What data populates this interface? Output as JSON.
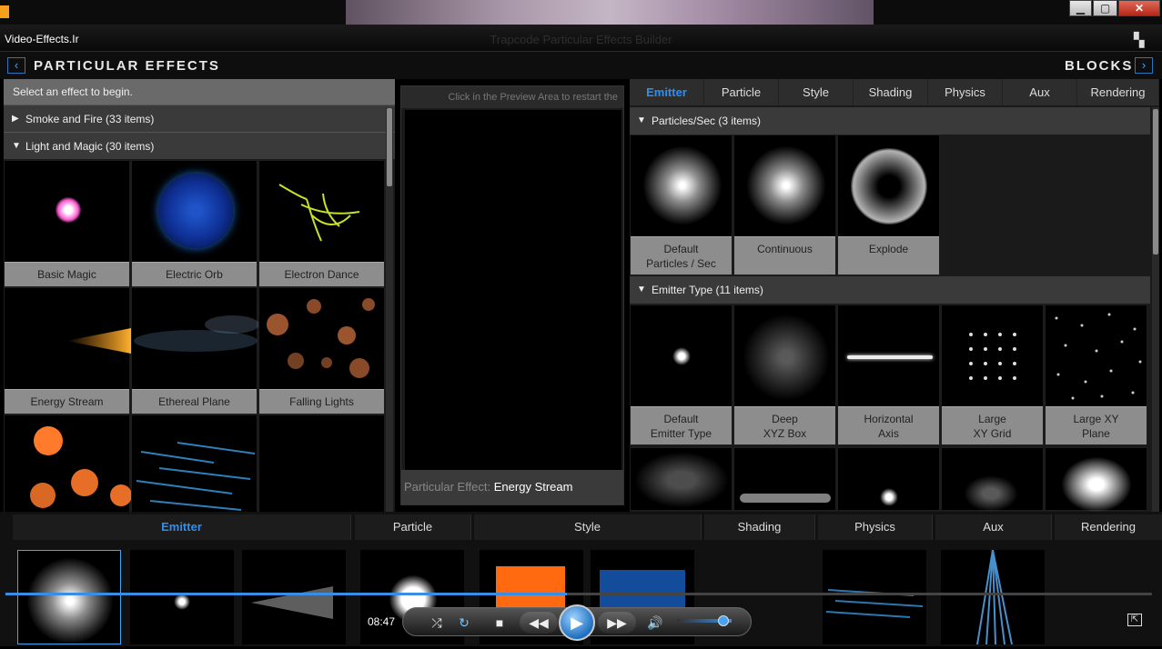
{
  "window": {
    "site": "Video-Effects.Ir",
    "title": "Trapcode Particular Effects Builder",
    "minimize": "▁",
    "maximize": "▢",
    "close": "✕"
  },
  "nav": {
    "left_title": "PARTICULAR EFFECTS",
    "right_title": "BLOCKS",
    "back_icon": "‹",
    "forward_icon": "›"
  },
  "effects_panel": {
    "hint": "Select an effect to begin.",
    "categories": [
      {
        "label": "Smoke and Fire (33 items)",
        "expanded": false
      },
      {
        "label": "Light and Magic (30 items)",
        "expanded": true
      }
    ],
    "effects": [
      {
        "label": "Basic Magic"
      },
      {
        "label": "Electric Orb"
      },
      {
        "label": "Electron Dance"
      },
      {
        "label": "Energy Stream"
      },
      {
        "label": "Ethereal Plane"
      },
      {
        "label": "Falling Lights"
      }
    ]
  },
  "preview": {
    "message": "Click in the Preview Area to restart the",
    "effect_key": "Particular Effect:",
    "effect_value": "Energy Stream"
  },
  "blocks_panel": {
    "tabs": [
      "Emitter",
      "Particle",
      "Style",
      "Shading",
      "Physics",
      "Aux",
      "Rendering"
    ],
    "active_tab": "Emitter",
    "sections": [
      {
        "label": "Particles/Sec  (3 items)",
        "items": [
          {
            "line1": "Default",
            "line2": "Particles / Sec"
          },
          {
            "line1": "Continuous",
            "line2": ""
          },
          {
            "line1": "Explode",
            "line2": ""
          }
        ]
      },
      {
        "label": "Emitter Type  (11 items)",
        "items": [
          {
            "line1": "Default",
            "line2": "Emitter Type"
          },
          {
            "line1": "Deep",
            "line2": "XYZ Box"
          },
          {
            "line1": "Horizontal",
            "line2": "Axis"
          },
          {
            "line1": "Large",
            "line2": "XY Grid"
          },
          {
            "line1": "Large XY",
            "line2": "Plane"
          }
        ]
      }
    ]
  },
  "bottom_tabs": [
    "Emitter",
    "Particle",
    "Style",
    "Shading",
    "Physics",
    "Aux",
    "Rendering"
  ],
  "player": {
    "time": "08:47",
    "progress": 0.49,
    "volume": 0.85
  }
}
